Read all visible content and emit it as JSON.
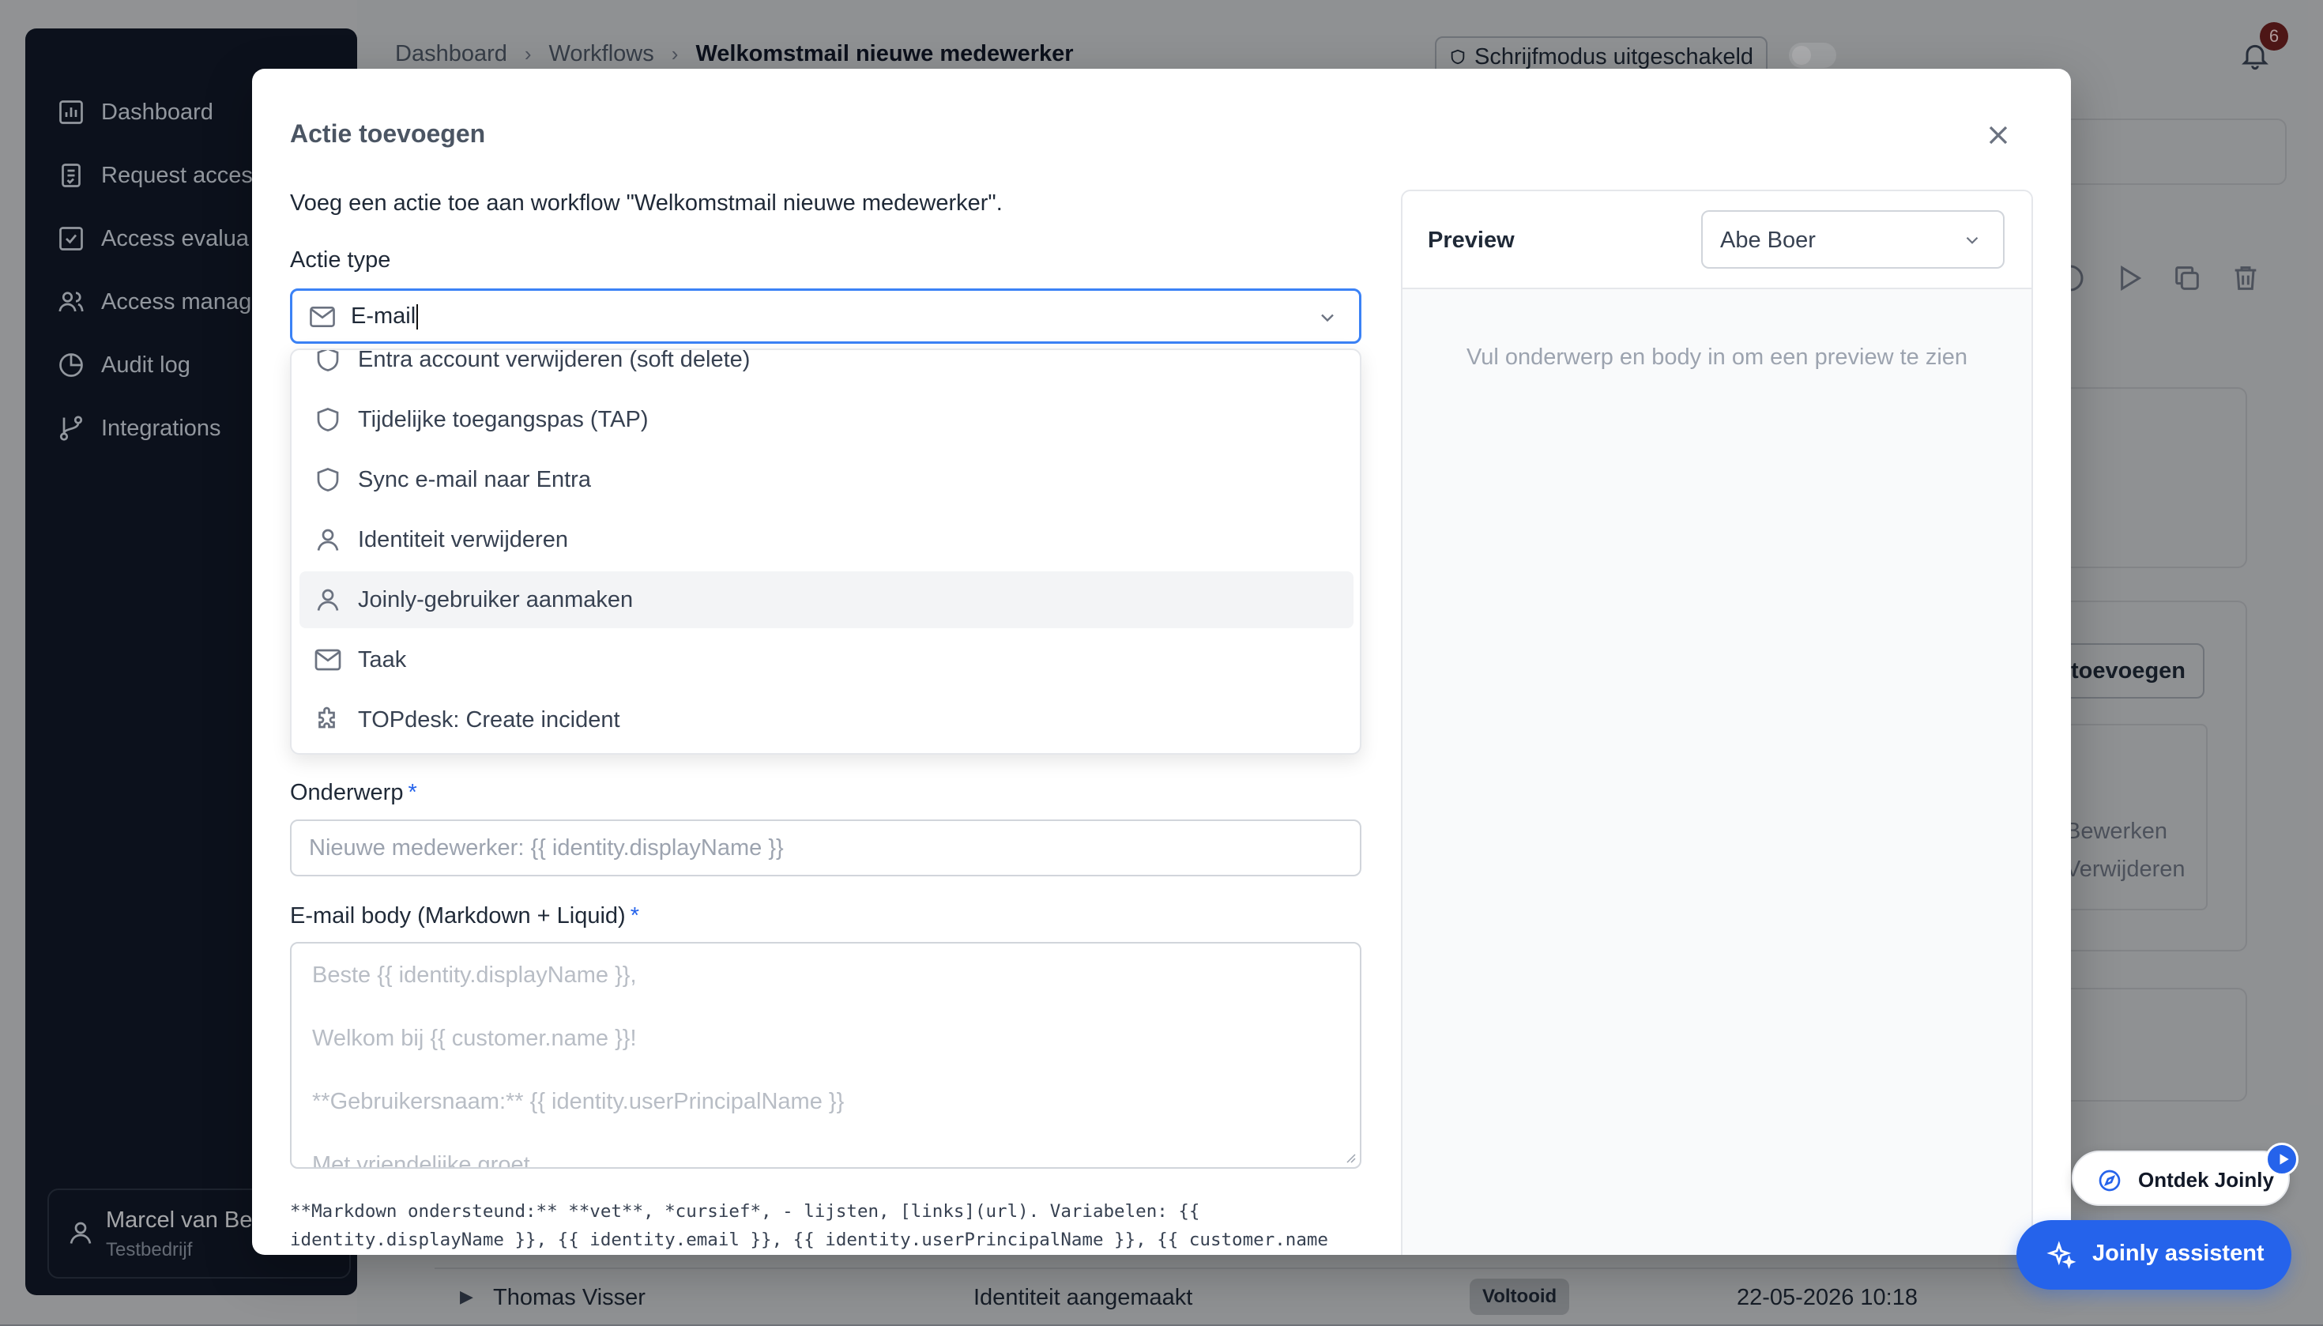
{
  "sidebar": {
    "items": [
      {
        "label": "Dashboard",
        "icon": "bar-chart-icon"
      },
      {
        "label": "Request acces",
        "icon": "clipboard-check-icon"
      },
      {
        "label": "Access evalua",
        "icon": "check-square-icon"
      },
      {
        "label": "Access manag",
        "icon": "users-icon"
      },
      {
        "label": "Audit log",
        "icon": "pie-chart-icon"
      },
      {
        "label": "Integrations",
        "icon": "git-branch-icon"
      }
    ],
    "user": {
      "name": "Marcel van Be",
      "company": "Testbedrijf"
    }
  },
  "header": {
    "breadcrumb": [
      "Dashboard",
      "Workflows",
      "Welkomstmail nieuwe medewerker"
    ],
    "mode_badge": "Schrijfmodus uitgeschakeld",
    "notification_count": "6"
  },
  "background": {
    "add_button_label": "toevoegen",
    "edit_label": "Bewerken",
    "delete_label": "Verwijderen",
    "row": {
      "name": "Thomas Visser",
      "event": "Identiteit aangemaakt",
      "status": "Voltooid",
      "date": "22-05-2026 10:18"
    }
  },
  "modal": {
    "title": "Actie toevoegen",
    "description": "Voeg een actie toe aan workflow \"Welkomstmail nieuwe medewerker\".",
    "action_type_label": "Actie type",
    "action_type_value": "E-mail",
    "options": [
      {
        "label": "Entra account verwijderen (soft delete)",
        "icon": "shield-icon"
      },
      {
        "label": "Tijdelijke toegangspas (TAP)",
        "icon": "shield-icon"
      },
      {
        "label": "Sync e-mail naar Entra",
        "icon": "shield-icon"
      },
      {
        "label": "Identiteit verwijderen",
        "icon": "user-icon"
      },
      {
        "label": "Joinly-gebruiker aanmaken",
        "icon": "user-icon"
      },
      {
        "label": "Taak",
        "icon": "mail-icon"
      },
      {
        "label": "TOPdesk: Create incident",
        "icon": "puzzle-icon"
      }
    ],
    "highlighted_option": "Joinly-gebruiker aanmaken",
    "subject_label": "Onderwerp",
    "subject_placeholder": "Nieuwe medewerker: {{ identity.displayName }}",
    "body_label": "E-mail body (Markdown + Liquid)",
    "body_placeholder_lines": [
      "Beste {{ identity.displayName }},",
      "Welkom bij {{ customer.name }}!",
      "**Gebruikersnaam:** {{ identity.userPrincipalName }}",
      "Met vriendelijke groet"
    ],
    "help_text": "**Markdown ondersteund:** **vet**, *cursief*, - lijsten, [links](url). Variabelen: {{ identity.displayName }}, {{ identity.email }}, {{ identity.userPrincipalName }}, {{ customer.name }}, {{ password }}",
    "preview": {
      "title": "Preview",
      "selected_identity": "Abe Boer",
      "empty_text": "Vul onderwerp en body in om een preview te zien"
    }
  },
  "floating": {
    "discover_label": "Ontdek Joinly",
    "assistant_label": "Joinly assistent"
  },
  "colors": {
    "accent": "#2563eb",
    "sidebar_bg": "#111827",
    "focus_ring": "#3b82f6"
  }
}
